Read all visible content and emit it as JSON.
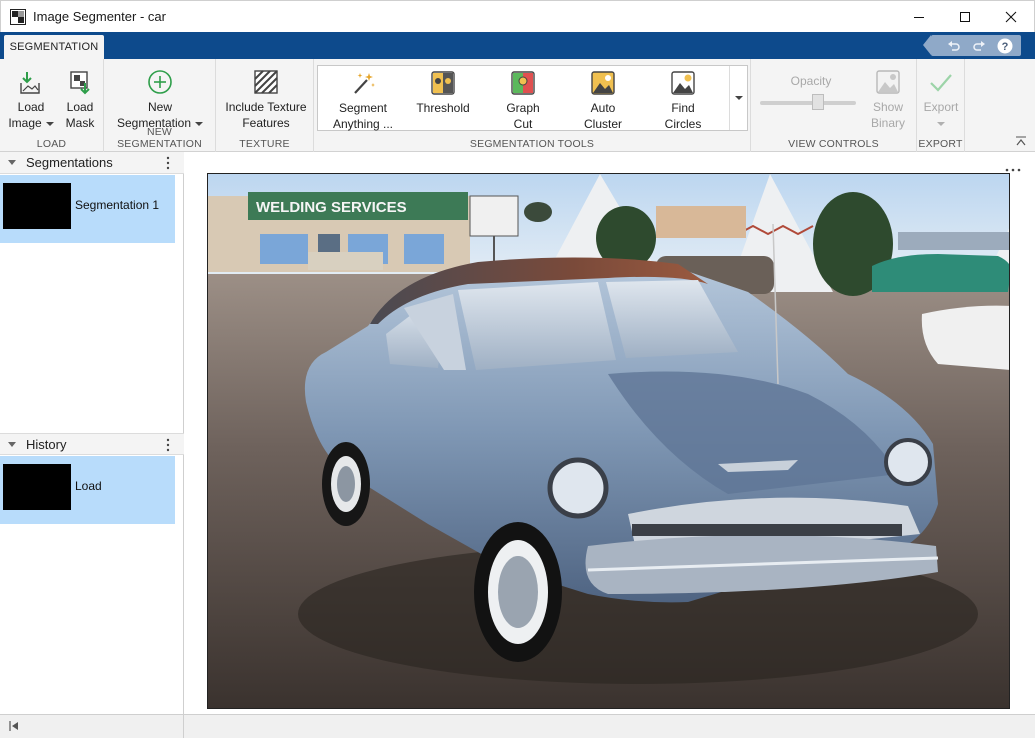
{
  "window": {
    "title": "Image Segmenter - car"
  },
  "ribbon": {
    "active_tab": "SEGMENTATION",
    "sections": {
      "load": {
        "label": "LOAD",
        "load_image": [
          "Load",
          "Image"
        ],
        "load_mask": [
          "Load",
          "Mask"
        ]
      },
      "new_segmentation": {
        "label": "NEW SEGMENTATION",
        "new": [
          "New",
          "Segmentation"
        ]
      },
      "texture": {
        "label": "TEXTURE",
        "include": [
          "Include Texture",
          "Features"
        ]
      },
      "segmentation_tools": {
        "label": "SEGMENTATION TOOLS",
        "tools": [
          {
            "line1": "Segment",
            "line2": "Anything ..."
          },
          {
            "line1": "Threshold",
            "line2": ""
          },
          {
            "line1": "Graph",
            "line2": "Cut"
          },
          {
            "line1": "Auto",
            "line2": "Cluster"
          },
          {
            "line1": "Find",
            "line2": "Circles"
          }
        ]
      },
      "view_controls": {
        "label": "VIEW CONTROLS",
        "opacity": "Opacity",
        "opacity_level": 0.6,
        "show_binary": [
          "Show",
          "Binary"
        ]
      },
      "export": {
        "label": "EXPORT",
        "export": "Export"
      }
    }
  },
  "panels": {
    "segmentations": {
      "title": "Segmentations",
      "items": [
        {
          "label": "Segmentation 1"
        }
      ]
    },
    "history": {
      "title": "History",
      "items": [
        {
          "label": "Load"
        }
      ]
    }
  },
  "colors": {
    "tab_strip": "#0d4a8c",
    "selected_item": "#b8dcfb",
    "ribbon_bg": "#f4f4f4"
  }
}
